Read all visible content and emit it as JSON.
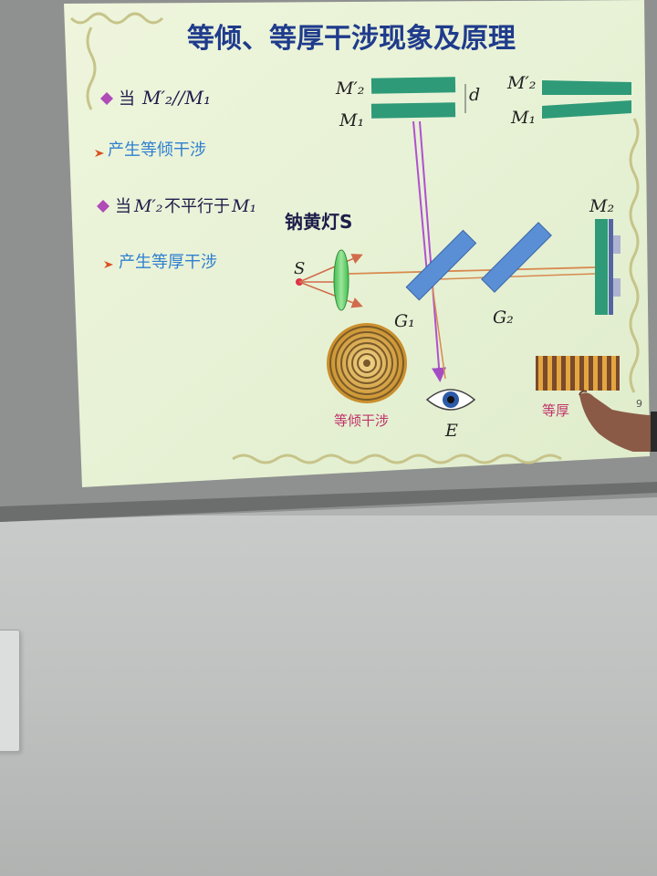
{
  "slide": {
    "title": "等倾、等厚干涉现象及原理",
    "bullet1_prefix": "当",
    "bullet1_math": "M′₂//M₁",
    "bullet1_result": "产生等倾干涉",
    "bullet2_prefix": "当",
    "bullet2_math": "M′₂",
    "bullet2_mid": "不平行于",
    "bullet2_math2": "M₁",
    "bullet2_result": "产生等厚干涉",
    "lamp_label": "钠黄灯S",
    "source_label": "S",
    "g1_label": "G₁",
    "g2_label": "G₂",
    "m2_label": "M₂",
    "m2prime_left": "M′₂",
    "m1_left": "M₁",
    "m2prime_right": "M′₂",
    "m1_right": "M₁",
    "d_label": "d",
    "eye_label": "E",
    "fringes_equal_inclination": "等倾干涉",
    "fringes_equal_thickness_partial": "等厚",
    "page_number": "9"
  },
  "colors": {
    "slide_bg": "#eef5dc",
    "title": "#1f3b8c",
    "bullet_diamond": "#b04bb7",
    "result_text": "#2f7fd0",
    "arrow_marker": "#d9501f",
    "mirror": "#2e9a78",
    "beamsplitter": "#5a8fd6",
    "beam_purple": "#b050d0",
    "beam_orange": "#d88a50",
    "fringe_gold": "#d9a53a"
  }
}
